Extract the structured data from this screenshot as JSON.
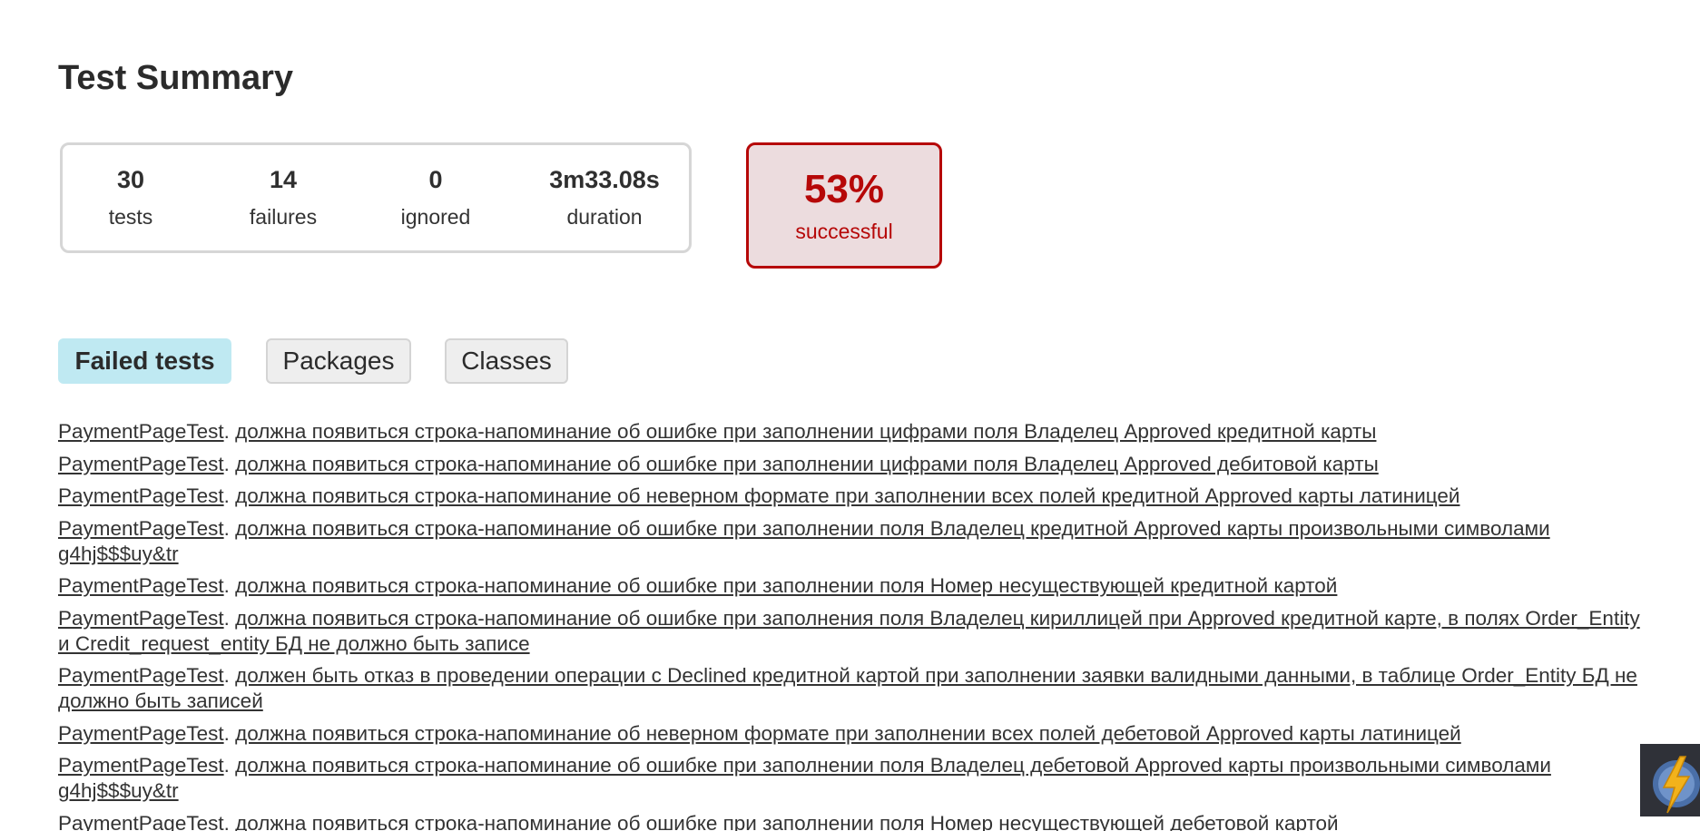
{
  "page": {
    "title": "Test Summary"
  },
  "summary": {
    "tests": {
      "value": "30",
      "label": "tests"
    },
    "failures": {
      "value": "14",
      "label": "failures"
    },
    "ignored": {
      "value": "0",
      "label": "ignored"
    },
    "duration": {
      "value": "3m33.08s",
      "label": "duration"
    }
  },
  "success_rate": {
    "percent": "53%",
    "label": "successful",
    "color": "#b60808",
    "background": "#ecdcde"
  },
  "tabs": [
    {
      "label": "Failed tests",
      "active": true
    },
    {
      "label": "Packages",
      "active": false
    },
    {
      "label": "Classes",
      "active": false
    }
  ],
  "failed_tests": [
    {
      "class": "PaymentPageTest",
      "separator": ". ",
      "test": "должна появиться строка-напоминание об ошибке при заполнении цифрами поля Владелец Approved кредитной карты"
    },
    {
      "class": "PaymentPageTest",
      "separator": ". ",
      "test": "должна появиться строка-напоминание об ошибке при заполнении цифрами поля Владелец Approved дебитовой карты"
    },
    {
      "class": "PaymentPageTest",
      "separator": ". ",
      "test": "должна появиться строка-напоминание об неверном формате при заполнении всех полей кредитной Approved карты латиницей"
    },
    {
      "class": "PaymentPageTest",
      "separator": ". ",
      "test": "должна появиться строка-напоминание об ошибке при заполнении поля Владелец кредитной Approved карты произвольными символами g4hj$$$uy&tr"
    },
    {
      "class": "PaymentPageTest",
      "separator": ". ",
      "test": "должна появиться строка-напоминание об ошибке при заполнении поля Номер несуществующей кредитной картой"
    },
    {
      "class": "PaymentPageTest",
      "separator": ". ",
      "test": "должна появиться строка-напоминание об ошибке при заполнения поля Владелец кириллицей при Approved кредитной карте, в полях Order_Entity и Credit_request_entity БД не должно быть записе"
    },
    {
      "class": "PaymentPageTest",
      "separator": ". ",
      "test": "должен быть отказ в проведении операции с Declined кредитной картой при заполнении заявки валидными данными, в таблице Order_Entity БД не должно быть записей"
    },
    {
      "class": "PaymentPageTest",
      "separator": ". ",
      "test": "должна появиться строка-напоминание об неверном формате при заполнении всех полей дебетовой Approved карты латиницей"
    },
    {
      "class": "PaymentPageTest",
      "separator": ". ",
      "test": "должна появиться строка-напоминание об ошибке при заполнении поля Владелец дебетовой Approved карты произвольными символами g4hj$$$uy&tr"
    },
    {
      "class": "PaymentPageTest",
      "separator": ". ",
      "test": "должна появиться строка-напоминание об ошибке при заполнении поля Номер несуществующей дебетовой картой"
    }
  ],
  "colors": {
    "tab_active_bg": "#bfe9f2",
    "tab_inactive_bg": "#eeeeee",
    "summary_border": "#d6d6d6"
  },
  "corner_widget": {
    "icon": "lightning-bolt-icon"
  }
}
